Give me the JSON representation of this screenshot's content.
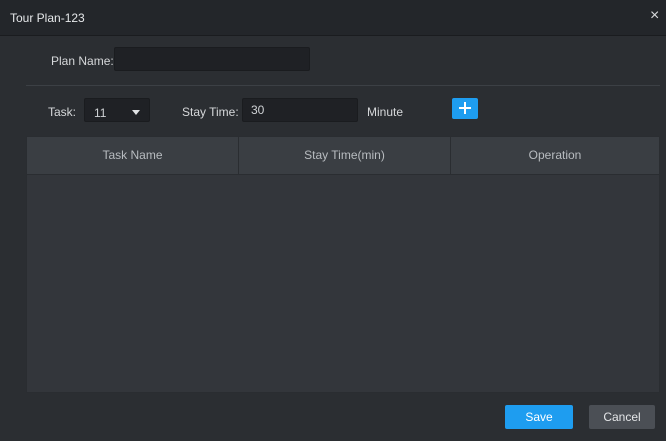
{
  "dialog": {
    "title": "Tour Plan-123",
    "close_icon": "close-icon"
  },
  "plan": {
    "name_label": "Plan Name:",
    "name_value": ""
  },
  "task_row": {
    "task_label": "Task:",
    "task_value": "11",
    "stay_label": "Stay Time:",
    "stay_value": "30",
    "unit_label": "Minute",
    "add_icon": "plus-icon"
  },
  "table": {
    "columns": [
      "Task Name",
      "Stay Time(min)",
      "Operation"
    ],
    "rows": []
  },
  "footer": {
    "save_label": "Save",
    "cancel_label": "Cancel"
  },
  "colors": {
    "accent": "#1e9df0",
    "background": "#2b2e32"
  }
}
